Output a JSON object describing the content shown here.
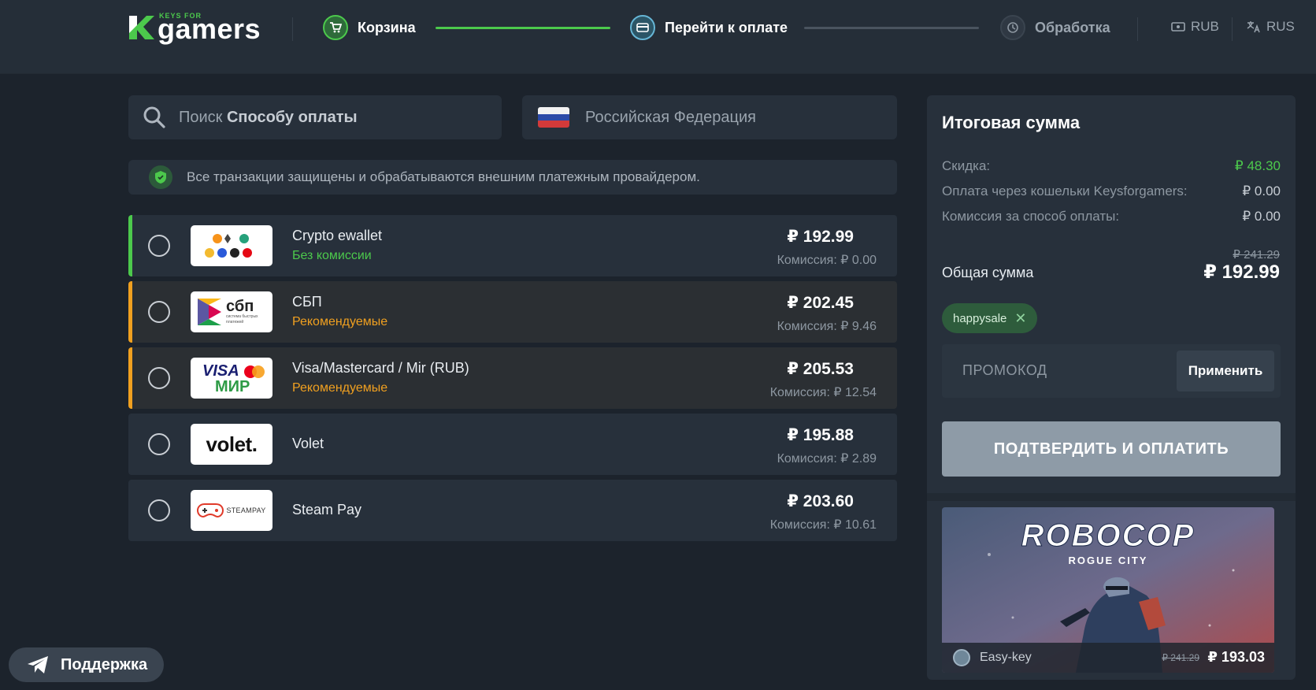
{
  "header": {
    "logo_top": "KEYS FOR",
    "logo_main": "gamers",
    "steps": [
      {
        "label": "Корзина"
      },
      {
        "label": "Перейти к оплате"
      },
      {
        "label": "Обработка"
      }
    ],
    "currency": "RUB",
    "language": "RUS"
  },
  "search": {
    "placeholder_prefix": "Поиск",
    "placeholder_bold": "Способу оплаты"
  },
  "country": {
    "name": "Российская Федерация"
  },
  "notice": {
    "text": "Все транзакции защищены и обрабатываются внешним платежным провайдером."
  },
  "payment_methods": [
    {
      "name": "Crypto ewallet",
      "tag": "Без комиссии",
      "price": "₽ 192.99",
      "fee": "Комиссия: ₽ 0.00",
      "accent_color": "#4cc94c"
    },
    {
      "name": "СБП",
      "tag": "Рекомендуемые",
      "price": "₽ 202.45",
      "fee": "Комиссия: ₽ 9.46",
      "accent_color": "#f0a020"
    },
    {
      "name": "Visa/Mastercard / Mir (RUB)",
      "tag": "Рекомендуемые",
      "price": "₽ 205.53",
      "fee": "Комиссия: ₽ 12.54",
      "accent_color": "#f0a020"
    },
    {
      "name": "Volet",
      "tag": "",
      "price": "₽ 195.88",
      "fee": "Комиссия: ₽ 2.89"
    },
    {
      "name": "Steam Pay",
      "tag": "",
      "price": "₽ 203.60",
      "fee": "Комиссия: ₽ 10.61"
    }
  ],
  "logos": {
    "sbp": "сбп",
    "sbp_sub": "система быстрых платежей",
    "visa": "VISA",
    "mir": "МИР",
    "volet": "volet.",
    "steampay": "STEAMPAY"
  },
  "summary": {
    "title": "Итоговая сумма",
    "lines": [
      {
        "label": "Скидка:",
        "value": "₽ 48.30"
      },
      {
        "label": "Оплата через кошельки Keysforgamers:",
        "value": "₽ 0.00"
      },
      {
        "label": "Комиссия за способ оплаты:",
        "value": "₽ 0.00"
      }
    ],
    "old_total": "₽ 241.29",
    "total_label": "Общая сумма",
    "total_value": "₽ 192.99",
    "coupon": "happysale",
    "promo_placeholder": "ПРОМОКОД",
    "apply_label": "Применить",
    "confirm_label": "ПОДТВЕРДИТЬ И ОПЛАТИТЬ"
  },
  "game": {
    "title": "ROBOCOP",
    "subtitle": "ROGUE CITY",
    "seller": "Easy-key",
    "old_price": "₽ 241.29",
    "price": "₽ 193.03"
  },
  "support": {
    "label": "Поддержка"
  },
  "colors": {
    "accent_green": "#4cc94c",
    "accent_orange": "#f0a020",
    "bg": "#1c232c",
    "panel": "#27303b"
  }
}
